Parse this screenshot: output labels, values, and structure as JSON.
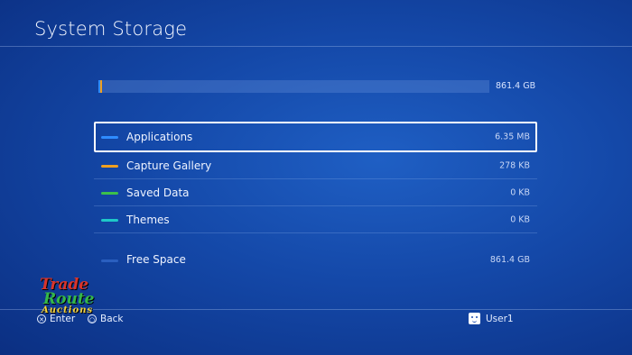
{
  "header": {
    "title": "System Storage"
  },
  "storage": {
    "total_label": "861.4 GB",
    "segments": [
      {
        "name": "Applications",
        "color": "#2f8cff",
        "fraction": 0.004
      },
      {
        "name": "Capture Gallery",
        "color": "#f0a020",
        "fraction": 0.002
      }
    ]
  },
  "categories": [
    {
      "label": "Applications",
      "size": "6.35 MB",
      "color": "#2f8cff",
      "selected": true
    },
    {
      "label": "Capture Gallery",
      "size": "278 KB",
      "color": "#f0a020",
      "selected": false
    },
    {
      "label": "Saved Data",
      "size": "0 KB",
      "color": "#3cc04a",
      "selected": false
    },
    {
      "label": "Themes",
      "size": "0 KB",
      "color": "#1ec8c8",
      "selected": false
    }
  ],
  "free_space": {
    "label": "Free Space",
    "size": "861.4 GB",
    "color": "#2a5fbf"
  },
  "footer": {
    "enter_label": "Enter",
    "back_label": "Back",
    "user_name": "User1"
  },
  "watermark": {
    "line1": "Trade",
    "line2": "Route",
    "line3": "Auctions"
  }
}
